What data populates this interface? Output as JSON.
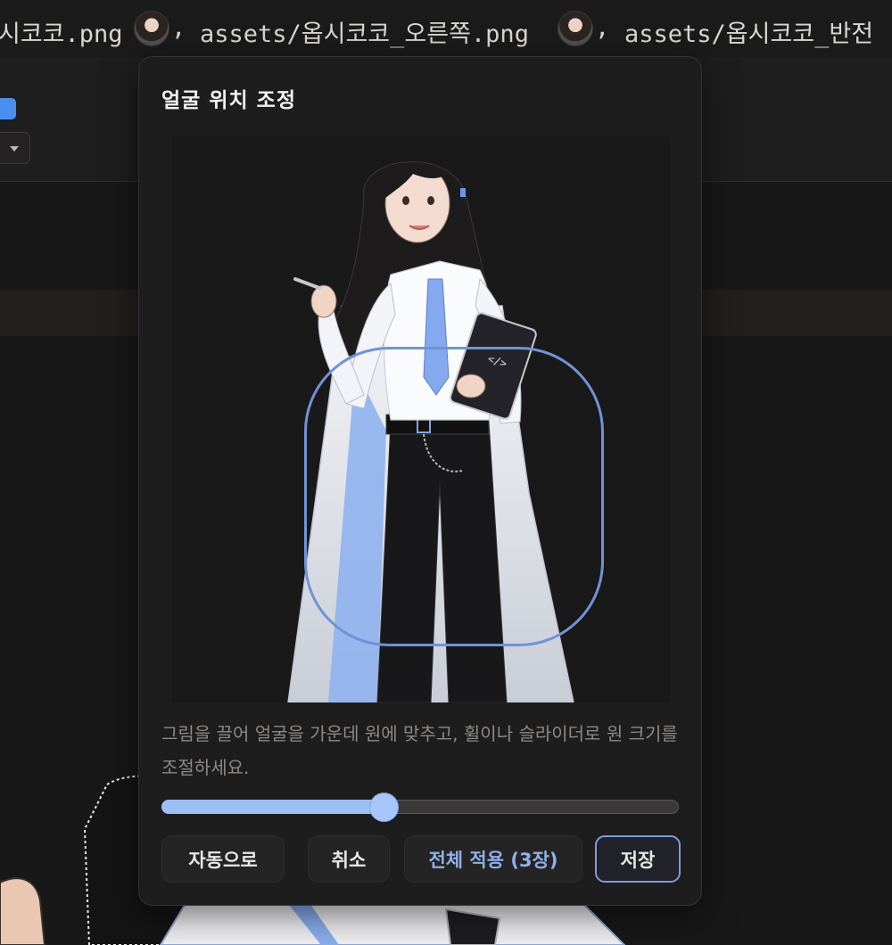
{
  "background": {
    "path_row": {
      "file1_tail": "시코코.png",
      "sep1": ",",
      "file2": "assets/옵시코코_오른쪽.png",
      "sep2": ",",
      "file3_head": "assets/옵시코코_반전"
    }
  },
  "modal": {
    "title": "얼굴 위치 조정",
    "hint": "그림을 끌어 얼굴을 가운데 원에 맞추고, 휠이나 슬라이더로 원 크기를 조절하세요.",
    "zoom_slider": {
      "value_fraction": 0.43
    },
    "buttons": {
      "auto": "자동으로",
      "cancel": "취소",
      "apply_all": "전체 적용 (3장)",
      "save": "저장"
    }
  },
  "colors": {
    "accent": "#7b9de0",
    "slider_fill": "#9cc0f5",
    "apply_text": "#8fb0ea",
    "modal_bg": "#1e1d1d"
  },
  "icons": {
    "thumbnail": "avatar-thumbnail-icon",
    "dropdown": "chevron-down-icon"
  }
}
